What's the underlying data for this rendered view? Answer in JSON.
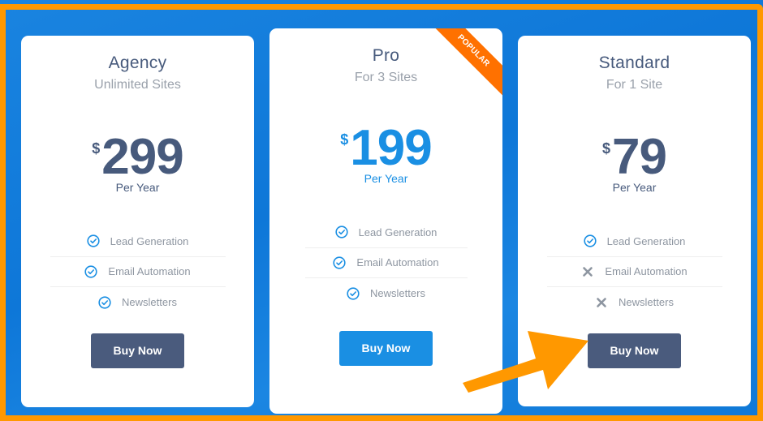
{
  "plans": [
    {
      "name": "Agency",
      "subtitle": "Unlimited Sites",
      "currency": "$",
      "price": "299",
      "period": "Per Year",
      "features": [
        {
          "label": "Lead Generation",
          "included": true,
          "icon": "check-circle-icon"
        },
        {
          "label": "Email Automation",
          "included": true,
          "icon": "check-circle-icon"
        },
        {
          "label": "Newsletters",
          "included": true,
          "icon": "check-circle-icon"
        }
      ],
      "button": "Buy Now"
    },
    {
      "name": "Pro",
      "subtitle": "For 3 Sites",
      "currency": "$",
      "price": "199",
      "period": "Per Year",
      "badge": "POPULAR",
      "features": [
        {
          "label": "Lead Generation",
          "included": true,
          "icon": "check-circle-icon"
        },
        {
          "label": "Email Automation",
          "included": true,
          "icon": "check-circle-icon"
        },
        {
          "label": "Newsletters",
          "included": true,
          "icon": "check-circle-icon"
        }
      ],
      "button": "Buy Now"
    },
    {
      "name": "Standard",
      "subtitle": "For 1 Site",
      "currency": "$",
      "price": "79",
      "period": "Per Year",
      "features": [
        {
          "label": "Lead Generation",
          "included": true,
          "icon": "check-circle-icon"
        },
        {
          "label": "Email Automation",
          "included": false,
          "icon": "x-icon"
        },
        {
          "label": "Newsletters",
          "included": false,
          "icon": "x-icon"
        }
      ],
      "button": "Buy Now"
    }
  ],
  "colors": {
    "background": "#1380dc",
    "frame": "#ff9800",
    "primary_text": "#475a7c",
    "accent": "#1a8fe3",
    "button_dark": "#4a5b7d",
    "ribbon": "#ff7100",
    "check": "#1a8fe3",
    "cross": "#8e96a1",
    "annotation_arrow": "#ff9800"
  }
}
